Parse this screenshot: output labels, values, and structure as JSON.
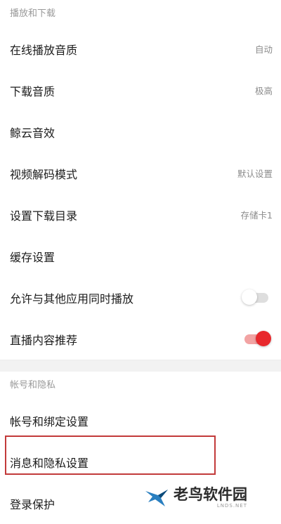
{
  "sections": {
    "playback": {
      "header": "播放和下载",
      "rows": [
        {
          "label": "在线播放音质",
          "value": "自动"
        },
        {
          "label": "下载音质",
          "value": "极高"
        },
        {
          "label": "鲸云音效",
          "value": ""
        },
        {
          "label": "视频解码模式",
          "value": "默认设置"
        },
        {
          "label": "设置下载目录",
          "value": "存储卡1"
        },
        {
          "label": "缓存设置",
          "value": ""
        },
        {
          "label": "允许与其他应用同时播放",
          "toggle": "off"
        },
        {
          "label": "直播内容推荐",
          "toggle": "on"
        }
      ]
    },
    "account": {
      "header": "帐号和隐私",
      "rows": [
        {
          "label": "帐号和绑定设置"
        },
        {
          "label": "消息和隐私设置"
        },
        {
          "label": "登录保护"
        }
      ]
    }
  },
  "highlighted_row": "消息和隐私设置",
  "colors": {
    "accent": "#e8282c",
    "highlight_border": "#c23a3a"
  },
  "watermark": {
    "title": "老鸟软件园",
    "subtitle": "LNDS.NET",
    "icon": "bird-logo-icon"
  }
}
